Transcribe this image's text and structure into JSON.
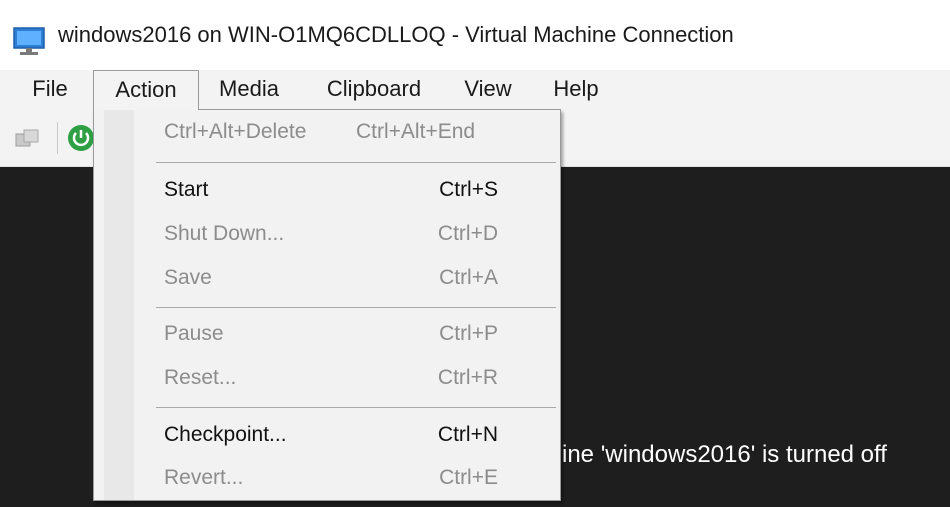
{
  "window": {
    "title": "windows2016 on WIN-O1MQ6CDLLOQ - Virtual Machine Connection",
    "icon": "monitor-icon"
  },
  "menubar": {
    "items": [
      "File",
      "Action",
      "Media",
      "Clipboard",
      "View",
      "Help"
    ],
    "active": "Action"
  },
  "toolbar": {
    "icons": [
      "ctrl-alt-del-icon",
      "start-power-icon"
    ]
  },
  "action_menu": {
    "items": [
      {
        "label": "Ctrl+Alt+Delete",
        "shortcut": "Ctrl+Alt+End",
        "enabled": false
      },
      {
        "label": "Start",
        "shortcut": "Ctrl+S",
        "enabled": true
      },
      {
        "label": "Shut Down...",
        "shortcut": "Ctrl+D",
        "enabled": false
      },
      {
        "label": "Save",
        "shortcut": "Ctrl+A",
        "enabled": false
      },
      {
        "label": "Pause",
        "shortcut": "Ctrl+P",
        "enabled": false
      },
      {
        "label": "Reset...",
        "shortcut": "Ctrl+R",
        "enabled": false
      },
      {
        "label": "Checkpoint...",
        "shortcut": "Ctrl+N",
        "enabled": true
      },
      {
        "label": "Revert...",
        "shortcut": "Ctrl+E",
        "enabled": false
      }
    ]
  },
  "vm_screen": {
    "status_text": "ine 'windows2016' is turned off"
  },
  "colors": {
    "menu_background": "#f2f2f2",
    "vm_background": "#1e1e1e",
    "disabled_text": "#8c8c8c",
    "power_icon": "#2ea043"
  }
}
